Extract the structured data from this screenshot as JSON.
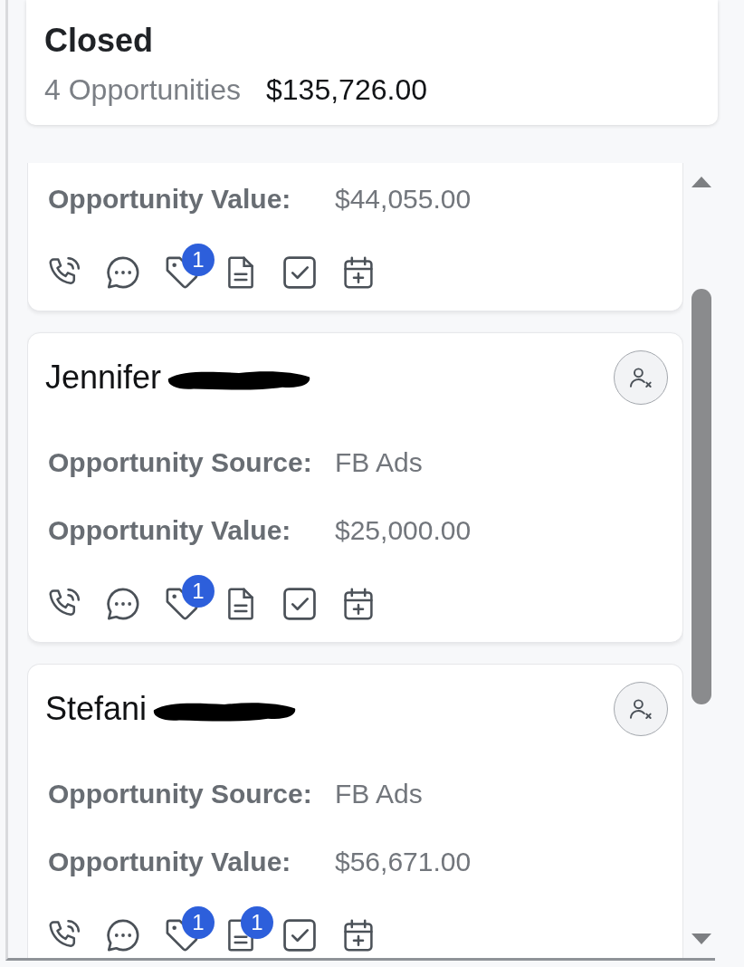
{
  "column": {
    "title": "Closed",
    "count": "4 Opportunities",
    "total": "$135,726.00"
  },
  "cards": [
    {
      "fields": [
        {
          "label": "Opportunity Value:",
          "value": "$44,055.00"
        }
      ],
      "actions": [
        {
          "kind": "call"
        },
        {
          "kind": "message"
        },
        {
          "kind": "tag",
          "badge": "1"
        },
        {
          "kind": "note"
        },
        {
          "kind": "task"
        },
        {
          "kind": "appointment"
        }
      ]
    },
    {
      "name": "Jennifer",
      "name_redacted": true,
      "fields": [
        {
          "label": "Opportunity Source:",
          "value": "FB Ads"
        },
        {
          "label": "Opportunity Value:",
          "value": "$25,000.00"
        }
      ],
      "actions": [
        {
          "kind": "call"
        },
        {
          "kind": "message"
        },
        {
          "kind": "tag",
          "badge": "1"
        },
        {
          "kind": "note"
        },
        {
          "kind": "task"
        },
        {
          "kind": "appointment"
        }
      ]
    },
    {
      "name": "Stefani",
      "name_redacted": true,
      "fields": [
        {
          "label": "Opportunity Source:",
          "value": "FB Ads"
        },
        {
          "label": "Opportunity Value:",
          "value": "$56,671.00"
        }
      ],
      "actions": [
        {
          "kind": "call"
        },
        {
          "kind": "message"
        },
        {
          "kind": "tag",
          "badge": "1"
        },
        {
          "kind": "note",
          "badge": "1"
        },
        {
          "kind": "task"
        },
        {
          "kind": "appointment"
        }
      ]
    }
  ]
}
